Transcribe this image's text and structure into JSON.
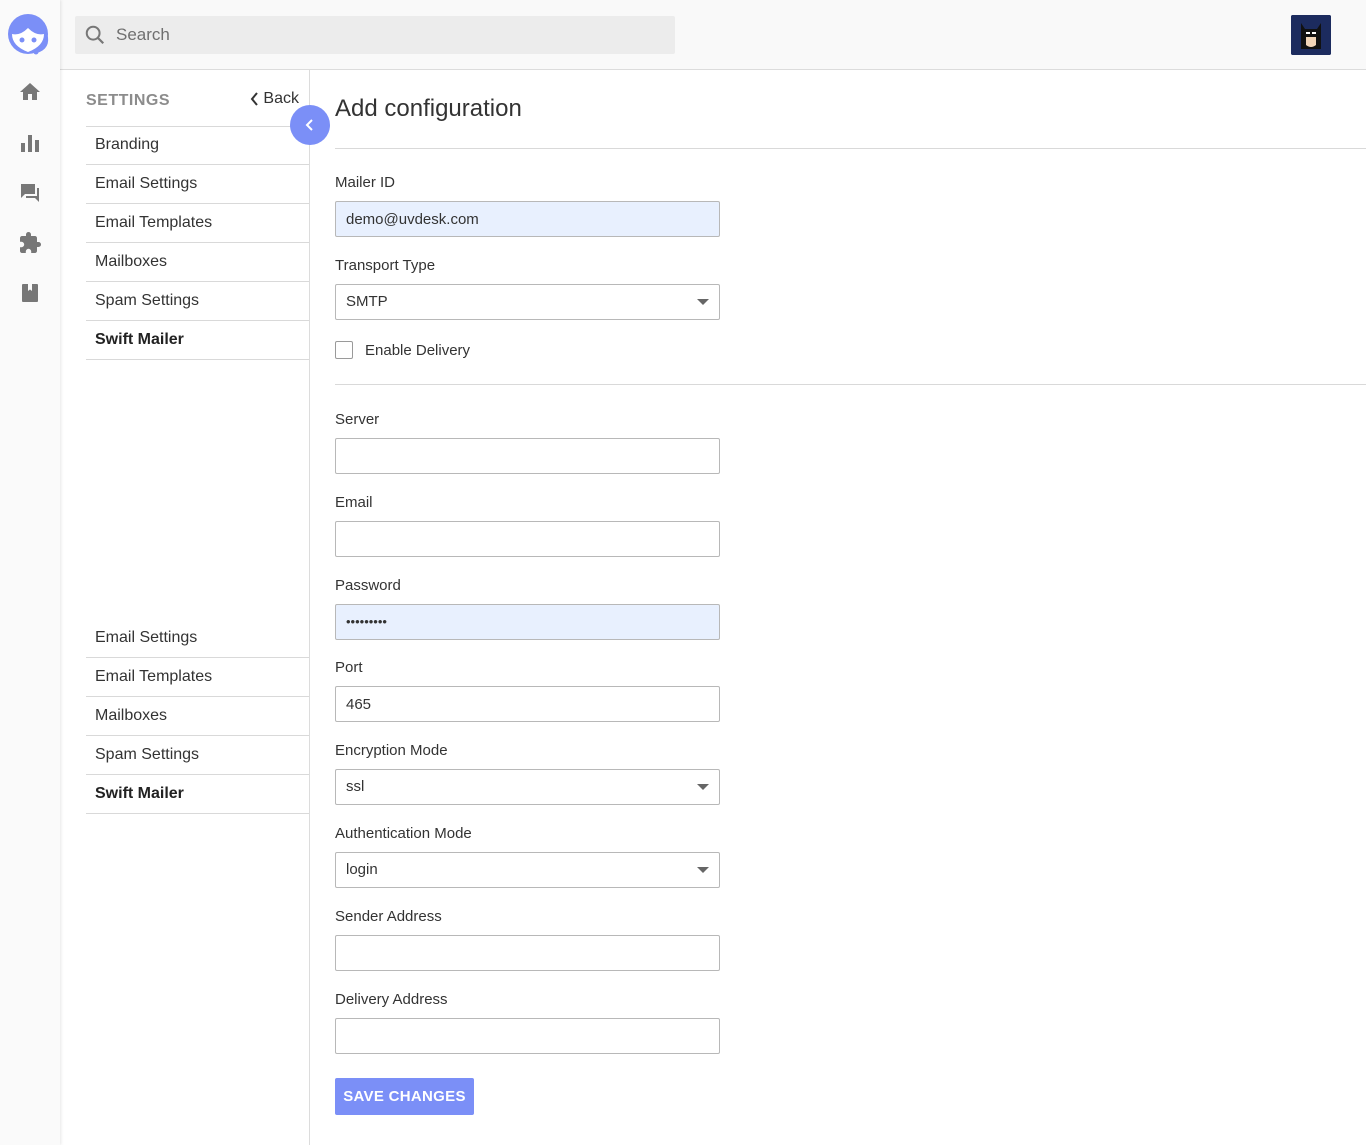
{
  "colors": {
    "accent": "#7b8ff7",
    "rail_icon": "#777777",
    "field_filled": "#e8f0fe"
  },
  "rail": {
    "logo_icon": "agent-headset-logo",
    "items": [
      "home-icon",
      "reports-icon",
      "threads-icon",
      "apps-icon",
      "knowledgebase-icon"
    ]
  },
  "topbar": {
    "search_placeholder": "Search",
    "avatar_icon": "user-avatar"
  },
  "settings": {
    "title": "SETTINGS",
    "back_label": "Back",
    "menu": [
      "Branding",
      "Email Settings",
      "Email Templates",
      "Mailboxes",
      "Spam Settings",
      "Swift Mailer"
    ],
    "menu_repeat": [
      "Email Settings",
      "Email Templates",
      "Mailboxes",
      "Spam Settings",
      "Swift Mailer"
    ],
    "active_item": "Swift Mailer"
  },
  "form": {
    "title": "Add configuration",
    "mailer_id": {
      "label": "Mailer ID",
      "value": "demo@uvdesk.com"
    },
    "transport_type": {
      "label": "Transport Type",
      "value": "SMTP"
    },
    "enable_delivery": {
      "label": "Enable Delivery",
      "checked": false
    },
    "server": {
      "label": "Server",
      "value": ""
    },
    "email": {
      "label": "Email",
      "value": ""
    },
    "password": {
      "label": "Password",
      "value": "•••••••••"
    },
    "port": {
      "label": "Port",
      "value": "465"
    },
    "encryption_mode": {
      "label": "Encryption Mode",
      "value": "ssl"
    },
    "authentication_mode": {
      "label": "Authentication Mode",
      "value": "login"
    },
    "sender_address": {
      "label": "Sender Address",
      "value": ""
    },
    "delivery_address": {
      "label": "Delivery Address",
      "value": ""
    },
    "save_label": "SAVE CHANGES"
  }
}
